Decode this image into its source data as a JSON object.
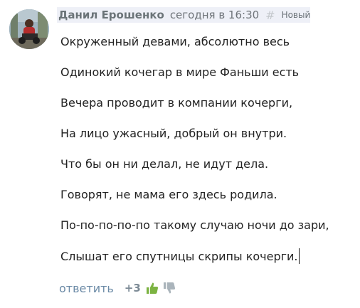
{
  "comment": {
    "author": "Данил Ерошенко",
    "time": "сегодня в 16:30",
    "anchor_symbol": "#",
    "badge": "Новый",
    "lines": [
      "Окруженный девами, абсолютно весь",
      "Одинокий кочегар в мире Фаньши есть",
      "Вечера проводит в компании кочерги,",
      "На лицо ужасный, добрый он внутри.",
      "Что бы он ни делал, не идут дела.",
      "Говорят, не мама его здесь родила.",
      "По-по-по-по-по такому случаю ночи до зари,",
      "Слышат его спутницы скрипы кочерги."
    ],
    "reply_label": "ответить",
    "score": "+3"
  },
  "icons": {
    "upvote": "thumbs-up-icon",
    "downvote": "thumbs-down-icon"
  },
  "colors": {
    "header_bg": "#eef0f7",
    "reply_link": "#6b8aa6",
    "thumb_up": "#7cb342",
    "thumb_down": "#aab4bb"
  }
}
